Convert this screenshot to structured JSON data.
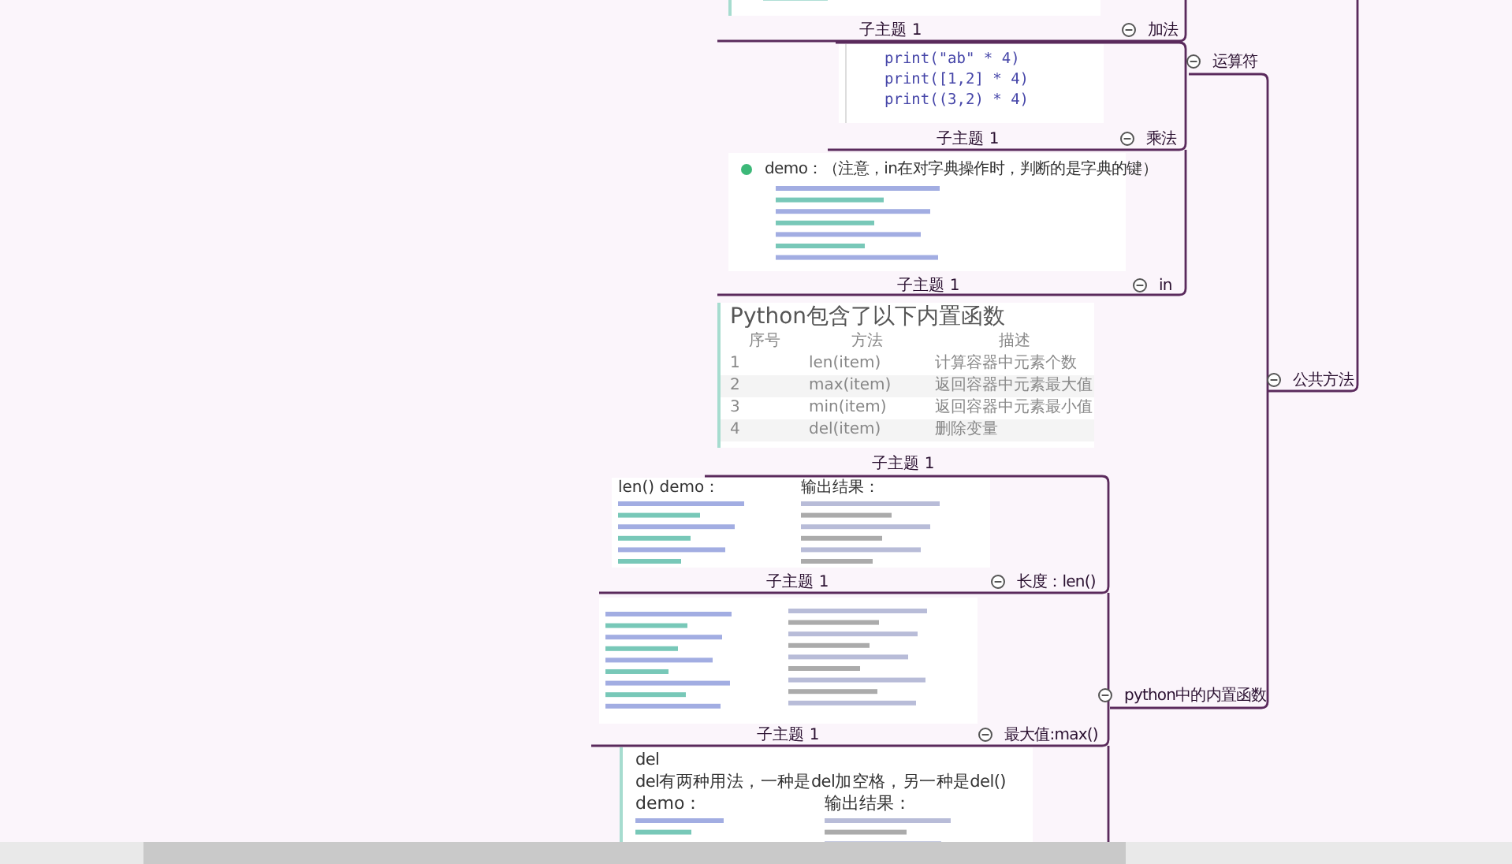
{
  "branches": [
    {
      "label": "公共方法",
      "expanded": true,
      "children": [
        {
          "label": "运算符",
          "expanded": true,
          "children": [
            {
              "label": "加法",
              "subtopic": "子主题 1",
              "image": {
                "kind": "cut"
              }
            },
            {
              "label": "乘法",
              "subtopic": "子主题 1",
              "image": {
                "kind": "code",
                "lines": [
                  "print(\"ab\" * 4)",
                  "print([1,2] * 4)",
                  "print((3,2) * 4)"
                ]
              }
            },
            {
              "label": "in",
              "subtopic": "子主题 1",
              "image": {
                "kind": "demo",
                "title": "demo：（注意，in在对字典操作时，判断的是字典的键）"
              }
            }
          ]
        },
        {
          "label": "python中的内置函数",
          "expanded": true,
          "children": [
            {
              "subtopic": "子主题 1",
              "image": {
                "kind": "table",
                "title": "Python包含了以下内置函数",
                "columns": [
                  "序号",
                  "方法",
                  "描述"
                ],
                "rows": [
                  [
                    "1",
                    "len(item)",
                    "计算容器中元素个数"
                  ],
                  [
                    "2",
                    "max(item)",
                    "返回容器中元素最大值"
                  ],
                  [
                    "3",
                    "min(item)",
                    "返回容器中元素最小值"
                  ],
                  [
                    "4",
                    "del(item)",
                    "删除变量"
                  ]
                ]
              }
            },
            {
              "label": "长度：len()",
              "subtopic": "子主题 1",
              "image": {
                "kind": "output",
                "heading": "len() demo：",
                "output_heading": "输出结果："
              }
            },
            {
              "label": "最大值:max()",
              "subtopic": "子主题 1",
              "image": {
                "kind": "output"
              }
            },
            {
              "image": {
                "kind": "notes",
                "lines": [
                  "del",
                  "del有两种用法，一种是del加空格，另一种是del()"
                ],
                "heading": "demo：",
                "output_heading": "输出结果："
              }
            }
          ]
        }
      ]
    }
  ]
}
